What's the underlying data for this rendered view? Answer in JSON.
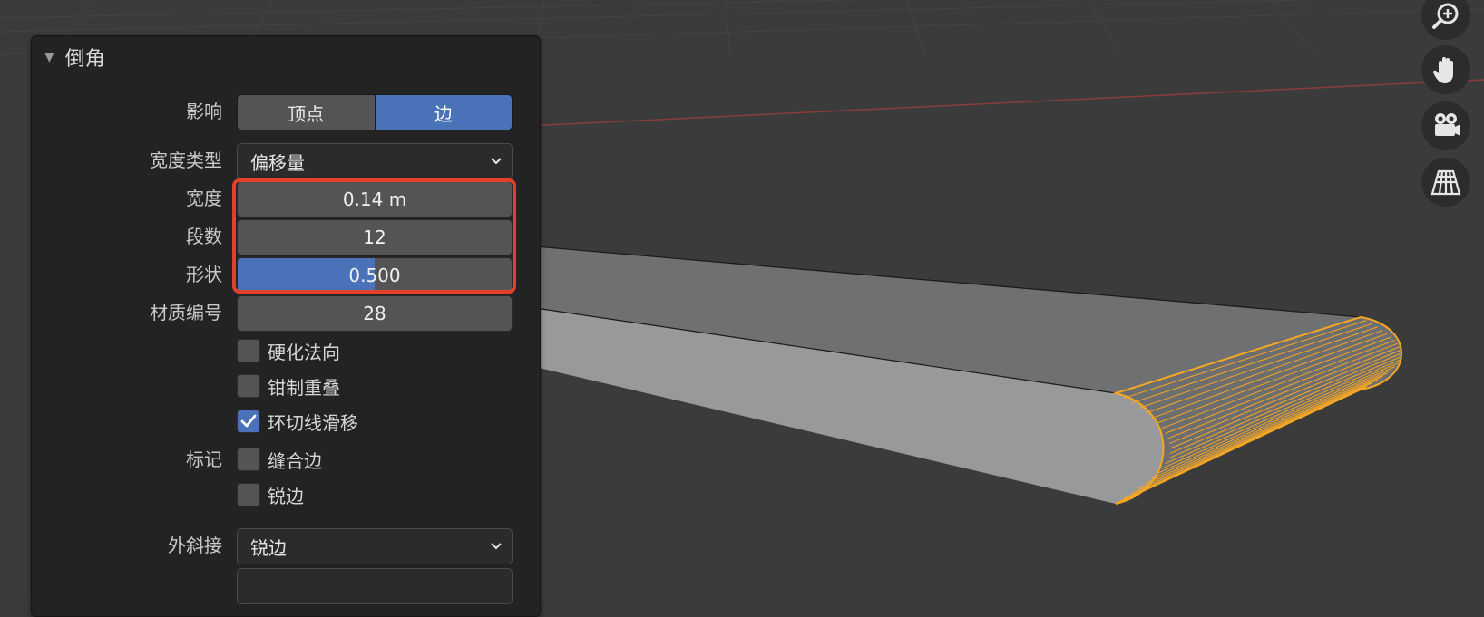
{
  "panel": {
    "title": "倒角",
    "affect": {
      "label": "影响",
      "options": [
        "顶点",
        "边"
      ],
      "selected": "边"
    },
    "width_type": {
      "label": "宽度类型",
      "value": "偏移量"
    },
    "width": {
      "label": "宽度",
      "value": "0.14 m"
    },
    "segments": {
      "label": "段数",
      "value": "12"
    },
    "shape": {
      "label": "形状",
      "value": "0.500",
      "fraction": 0.5
    },
    "material": {
      "label": "材质编号",
      "value": "28"
    },
    "harden_normals": {
      "label": "硬化法向",
      "checked": false
    },
    "clamp_overlap": {
      "label": "钳制重叠",
      "checked": false
    },
    "loop_slide": {
      "label": "环切线滑移",
      "checked": true
    },
    "mark": {
      "label": "标记"
    },
    "mark_seam": {
      "label": "缝合边",
      "checked": false
    },
    "mark_sharp": {
      "label": "锐边",
      "checked": false
    },
    "miter_outer": {
      "label": "外斜接",
      "value": "锐边"
    }
  },
  "nav_buttons": [
    "zoom-icon",
    "hand-pan-icon",
    "camera-icon",
    "grid-perspective-icon"
  ],
  "colors": {
    "accent": "#4a72b8",
    "highlight": "#e2402b",
    "selection": "#f5a623"
  }
}
